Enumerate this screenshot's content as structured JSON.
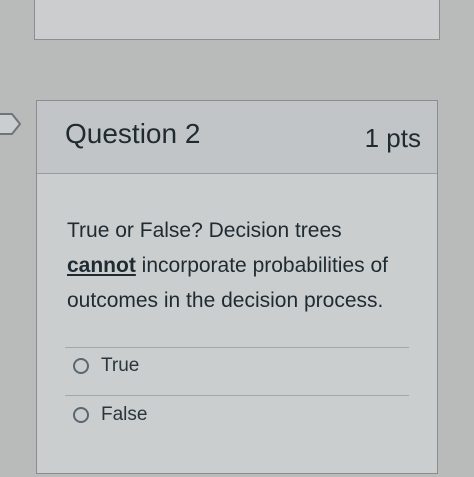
{
  "question": {
    "title": "Question 2",
    "points": "1 pts",
    "text_part1": "True or False? Decision trees",
    "text_emphasis": "cannot",
    "text_part2": " incorporate probabilities of outcomes in the decision process."
  },
  "answers": [
    {
      "label": "True",
      "selected": false
    },
    {
      "label": "False",
      "selected": false
    }
  ]
}
